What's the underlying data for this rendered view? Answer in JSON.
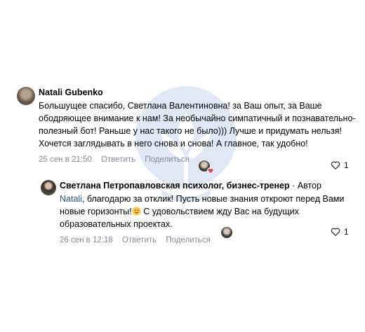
{
  "comments": [
    {
      "author": "Natali Gubenko",
      "text": "Большущее спасибо, Светлана Валентиновна! за Ваш опыт, за Ваше ободряющее внимание к нам! За необычайно симпатичный и познавательно-полезный бот! Раньше у нас такого не было))) Лучше и придумать нельзя! Хочется заглядывать в него снова и снова! А главное, так удобно!",
      "date": "25 сен в 21:50",
      "reply_label": "Ответить",
      "share_label": "Поделиться",
      "like_count": "1"
    },
    {
      "author": "Светлана Петропавловская психолог, бизнес-тренер",
      "role": "· Автор",
      "mention": "Natali",
      "text_part1": ", благодарю за отклик! Пусть новые знания откроют перед Вами новые горизонты!",
      "emoji": "smiling-face-with-heart-eyes",
      "text_part2": " С удовольствием жду Вас на будущих образовательных проектах.",
      "date": "26 сен в 12:18",
      "reply_label": "Ответить",
      "share_label": "Поделиться",
      "like_count": "1"
    }
  ],
  "colors": {
    "link": "#2a5885",
    "meta": "#818c99",
    "heart": "#e64646",
    "watermark": "#4a78c8"
  }
}
